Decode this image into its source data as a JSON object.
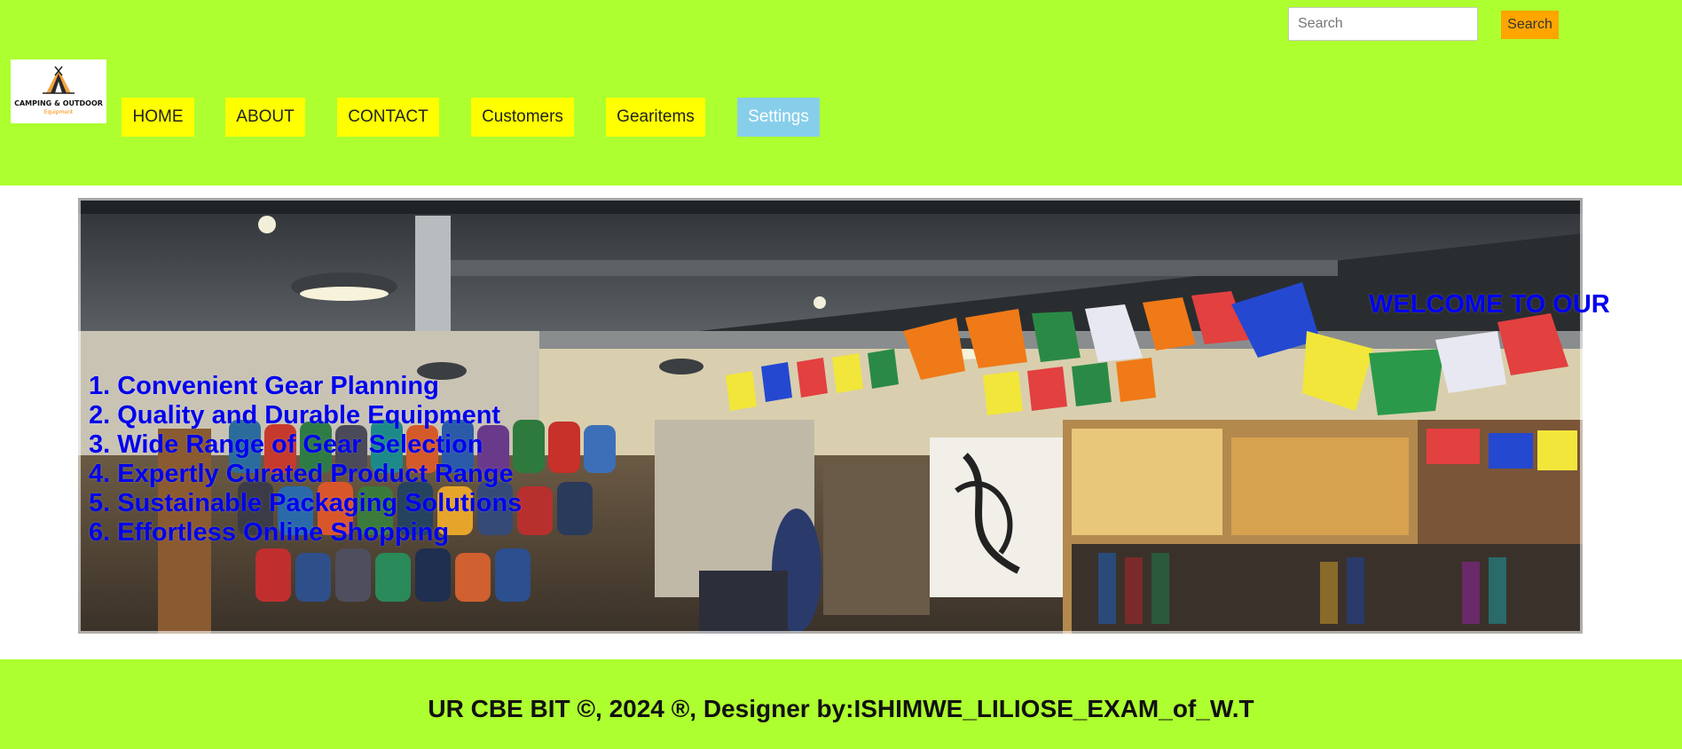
{
  "header": {
    "logo": {
      "title": "CAMPING & OUTDOOR",
      "subtitle": "Equipment",
      "icon": "tent-icon"
    },
    "search": {
      "placeholder": "Search",
      "value": "",
      "button_label": "Search"
    },
    "nav": [
      {
        "label": "HOME",
        "active": false
      },
      {
        "label": "ABOUT",
        "active": false
      },
      {
        "label": "CONTACT",
        "active": false
      },
      {
        "label": "Customers",
        "active": false
      },
      {
        "label": "Gearitems",
        "active": false
      },
      {
        "label": "Settings",
        "active": true
      }
    ]
  },
  "hero": {
    "image": "camping-store-photo",
    "welcome": "WELCOME TO OUR",
    "features": [
      "1. Convenient Gear Planning",
      "2. Quality and Durable Equipment",
      "3. Wide Range of Gear Selection",
      "4. Expertly Curated Product Range",
      "5. Sustainable Packaging Solutions",
      "6. Effortless Online Shopping"
    ]
  },
  "footer": {
    "text": "UR CBE BIT ©, 2024 ®, Designer by:ISHIMWE_LILIOSE_EXAM_of_W.T"
  },
  "colors": {
    "header_bg": "#adff2f",
    "nav_bg": "#ffff00",
    "nav_active_bg": "#87ceeb",
    "search_button_bg": "#ffa500",
    "hero_text": "#0000ee"
  }
}
